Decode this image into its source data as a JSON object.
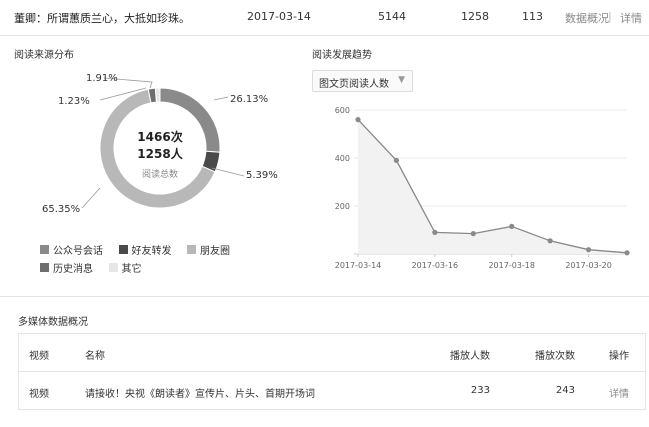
{
  "article": {
    "title": "董卿：所谓蕙质兰心，大抵如珍珠。",
    "date": "2017-03-14",
    "reads": "5144",
    "users": "1258",
    "shares": "113",
    "overview_link": "数据概况",
    "divider": "|",
    "detail_link": "详情"
  },
  "source_section": {
    "title": "阅读来源分布",
    "center_count": "1466次",
    "center_users": "1258人",
    "center_label": "阅读总数"
  },
  "donut_labels": [
    "1.91%",
    "1.23%",
    "26.13%",
    "5.39%",
    "65.35%"
  ],
  "legend": [
    {
      "label": "公众号会话",
      "color": "#8a8a8a"
    },
    {
      "label": "好友转发",
      "color": "#4a4a4a"
    },
    {
      "label": "朋友圈",
      "color": "#b8b8b8"
    },
    {
      "label": "历史消息",
      "color": "#6e6e6e"
    },
    {
      "label": "其它",
      "color": "#e6e6e6"
    }
  ],
  "trend_section": {
    "title": "阅读发展趋势",
    "dropdown_value": "图文页阅读人数"
  },
  "chart_data": [
    {
      "type": "pie",
      "categories": [
        "公众号会话",
        "好友转发",
        "朋友圈",
        "历史消息",
        "其它"
      ],
      "values": [
        26.13,
        5.39,
        65.35,
        1.91,
        1.23
      ],
      "colors": [
        "#8a8a8a",
        "#4a4a4a",
        "#b8b8b8",
        "#6e6e6e",
        "#e6e6e6"
      ],
      "legend": "bottom"
    },
    {
      "type": "line",
      "x": [
        "2017-03-14",
        "2017-03-15",
        "2017-03-16",
        "2017-03-17",
        "2017-03-18",
        "2017-03-19",
        "2017-03-20",
        "2017-03-21"
      ],
      "values": [
        560,
        390,
        90,
        85,
        115,
        55,
        18,
        5
      ],
      "x_tick_labels": [
        "2017-03-14",
        "2017-03-16",
        "2017-03-18",
        "2017-03-20"
      ],
      "y_ticks": [
        200,
        400,
        600
      ],
      "ylim": [
        0,
        600
      ],
      "grid": true,
      "line_color": "#888888"
    }
  ],
  "media_section": {
    "title": "多媒体数据概况",
    "headers": {
      "type": "视频",
      "name": "名称",
      "plays_users": "播放人数",
      "plays_count": "播放次数",
      "op": "操作"
    },
    "rows": [
      {
        "type": "视频",
        "name": "请接收！央视《朗读者》宣传片、片头、首期开场词",
        "plays_users": "233",
        "plays_count": "243",
        "op": "详情"
      }
    ]
  }
}
